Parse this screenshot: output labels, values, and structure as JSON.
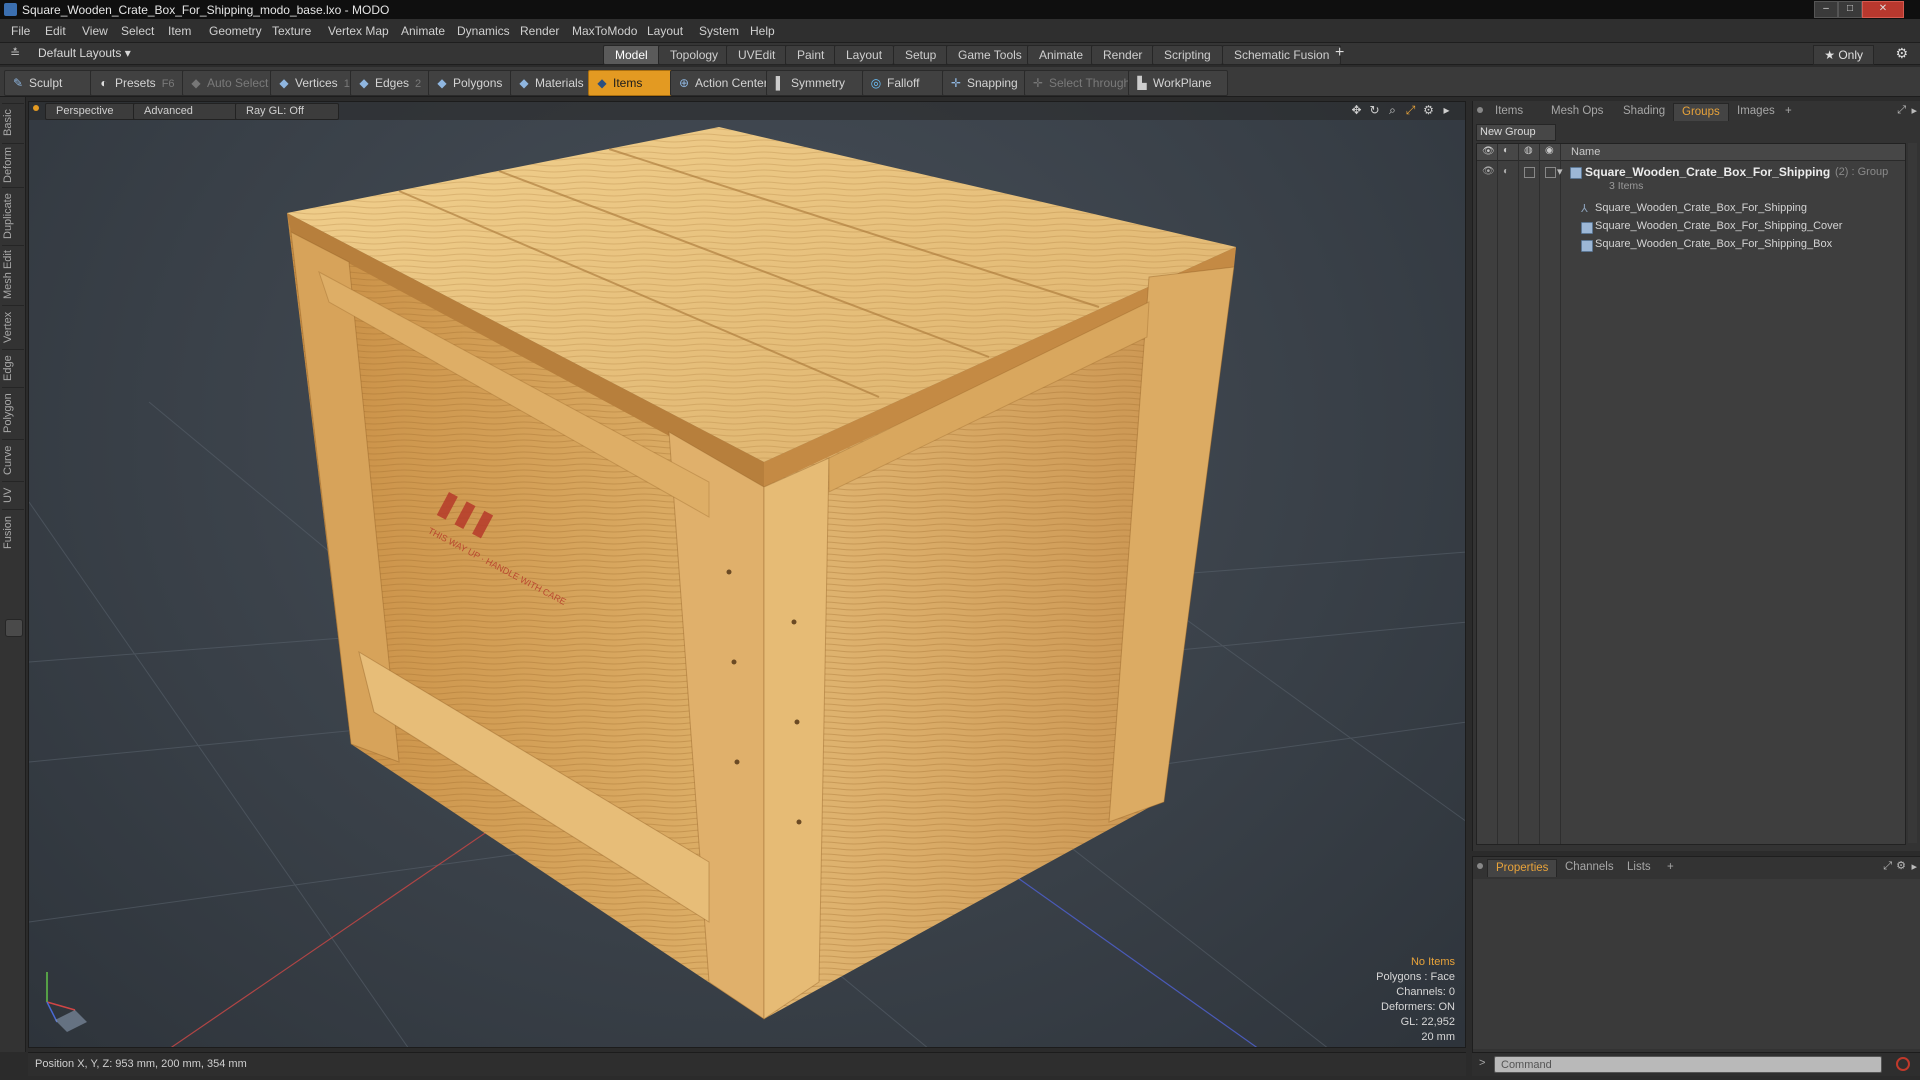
{
  "window": {
    "title": "Square_Wooden_Crate_Box_For_Shipping_modo_base.lxo - MODO",
    "minimize": "–",
    "maximize": "□",
    "close": "✕"
  },
  "menu": [
    "File",
    "Edit",
    "View",
    "Select",
    "Item",
    "Geometry",
    "Texture",
    "Vertex Map",
    "Animate",
    "Dynamics",
    "Render",
    "MaxToModo",
    "Layout",
    "System",
    "Help"
  ],
  "layoutbar": {
    "layouts_label": "Default Layouts ▾",
    "tabs": [
      "Model",
      "Topology",
      "UVEdit",
      "Paint",
      "Layout",
      "Setup",
      "Game Tools",
      "Animate",
      "Render",
      "Scripting",
      "Schematic Fusion"
    ],
    "active_tab": "Model",
    "add": "+",
    "only_label": "★  Only"
  },
  "toolbar": {
    "sculpt": "Sculpt",
    "presets": "Presets",
    "presets_key": "F6",
    "auto_select": "Auto Select",
    "vertices": "Vertices",
    "vertices_count": "1",
    "edges": "Edges",
    "edges_count": "2",
    "polygons": "Polygons",
    "materials": "Materials",
    "items": "Items",
    "action_center": "Action Center",
    "symmetry": "Symmetry",
    "falloff": "Falloff",
    "snapping": "Snapping",
    "select_through": "Select Through",
    "workplane": "WorkPlane"
  },
  "left_tabs": [
    "Basic",
    "Deform",
    "Duplicate",
    "Mesh Edit",
    "Vertex",
    "Edge",
    "Polygon",
    "Curve",
    "UV",
    "Fusion"
  ],
  "viewport": {
    "view": "Perspective",
    "shading": "Advanced",
    "raygl": "Ray GL: Off",
    "crate_stencil": "THIS WAY UP  ·  HANDLE WITH CARE",
    "info": {
      "items": "No Items",
      "polygons": "Polygons : Face",
      "channels": "Channels: 0",
      "deformers": "Deformers: ON",
      "gl": "GL: 22,952",
      "scale": "20 mm"
    }
  },
  "groups_panel": {
    "tabs": [
      "Items",
      "Mesh Ops",
      "Shading",
      "Groups",
      "Images",
      "+"
    ],
    "active_tab": "Groups",
    "new_group": "New Group",
    "column_name": "Name",
    "group": {
      "name": "Square_Wooden_Crate_Box_For_Shipping",
      "suffix": "(2) : Group",
      "count": "3 Items",
      "children": [
        "Square_Wooden_Crate_Box_For_Shipping",
        "Square_Wooden_Crate_Box_For_Shipping_Cover",
        "Square_Wooden_Crate_Box_For_Shipping_Box"
      ]
    }
  },
  "props_panel": {
    "tabs": [
      "Properties",
      "Channels",
      "Lists",
      "+"
    ],
    "active_tab": "Properties"
  },
  "status": {
    "position": "Position X, Y, Z:  953 mm, 200 mm, 354 mm"
  },
  "command": {
    "placeholder": "Command"
  },
  "colors": {
    "accent": "#e39a22",
    "active_tab_text": "#e8a33a",
    "wood_light": "#e8c27c",
    "wood_mid": "#d5a45c",
    "wood_dark": "#b97f3a"
  }
}
